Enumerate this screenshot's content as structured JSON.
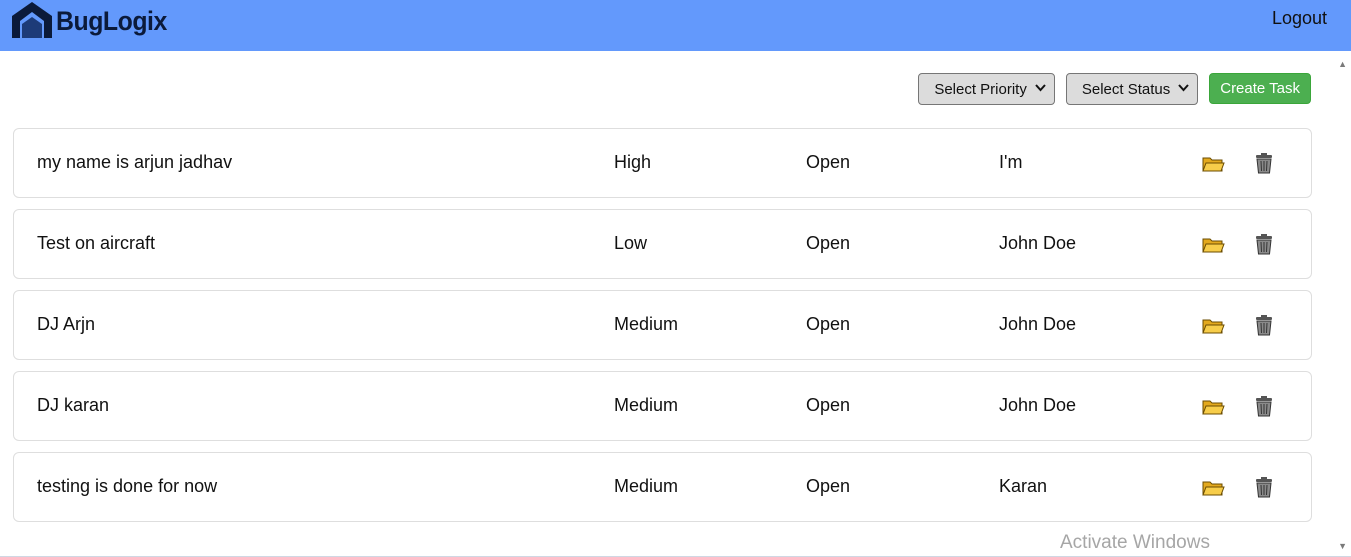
{
  "app": {
    "name": "BugLogix"
  },
  "header": {
    "logout_label": "Logout"
  },
  "toolbar": {
    "priority_select": "Select Priority",
    "status_select": "Select Status",
    "create_label": "Create Task"
  },
  "tasks": [
    {
      "title": "my name is arjun jadhav",
      "priority": "High",
      "status": "Open",
      "assignee": "I'm"
    },
    {
      "title": "Test on aircraft",
      "priority": "Low",
      "status": "Open",
      "assignee": "John Doe"
    },
    {
      "title": "DJ Arjn",
      "priority": "Medium",
      "status": "Open",
      "assignee": "John Doe"
    },
    {
      "title": "DJ karan",
      "priority": "Medium",
      "status": "Open",
      "assignee": "John Doe"
    },
    {
      "title": "testing is done for now",
      "priority": "Medium",
      "status": "Open",
      "assignee": "Karan"
    }
  ],
  "icons": {
    "edit": "folder-icon",
    "delete": "trash-icon",
    "logo": "chevron-logo-icon"
  },
  "colors": {
    "header": "#6399fc",
    "create_button": "#4caf50",
    "folder": "#f5c542"
  },
  "watermark": "Activate Windows"
}
